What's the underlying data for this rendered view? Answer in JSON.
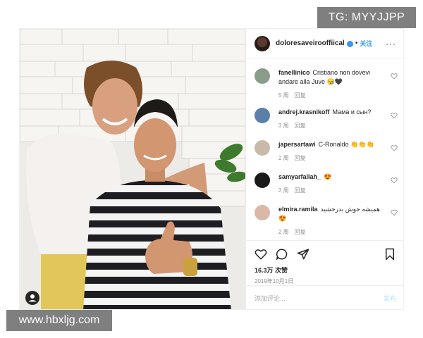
{
  "watermark": {
    "top_text": "TG: MYYJJPP",
    "bottom_text": "www.hbxljg.com"
  },
  "post": {
    "username": "doloresaveirooffiical",
    "follow_label": "关注",
    "more_glyph": "···",
    "likes": "16.3万 次赞",
    "date": "2019年10月1日",
    "add_comment_placeholder": "添加评论...",
    "publish_label": "发布"
  },
  "comments": [
    {
      "user": "fanellinico",
      "text": "Cristiano non dovevi andare alla Juve 😪🖤",
      "time": "5 周",
      "reply": "回复",
      "avatar_color": "#8a9c8a"
    },
    {
      "user": "andrej.krasnikoff",
      "text": "Мама и сын?",
      "time": "3 周",
      "reply": "回复",
      "avatar_color": "#5a7fa8"
    },
    {
      "user": "japersartawi",
      "text": "C-Ronaldo 👏👏👏",
      "time": "2 周",
      "reply": "回复",
      "avatar_color": "#c9b9a8"
    },
    {
      "user": "samyarfallah_",
      "text": "😍",
      "time": "2 周",
      "reply": "回复",
      "avatar_color": "#1a1a1a"
    },
    {
      "user": "elmira.ramila",
      "text": "همیشه خوش بدرخشید😍",
      "time": "2 周",
      "reply": "回复",
      "avatar_color": "#d9b8a8"
    }
  ],
  "icons": {
    "like": "heart-icon",
    "comment": "speech-bubble-icon",
    "share": "paper-plane-icon",
    "save": "bookmark-icon",
    "tag": "user-tag-icon",
    "verified": "verified-badge-icon"
  },
  "colors": {
    "link_blue": "#3897f0",
    "muted_text": "#8e8e8e",
    "border": "#efefef"
  }
}
